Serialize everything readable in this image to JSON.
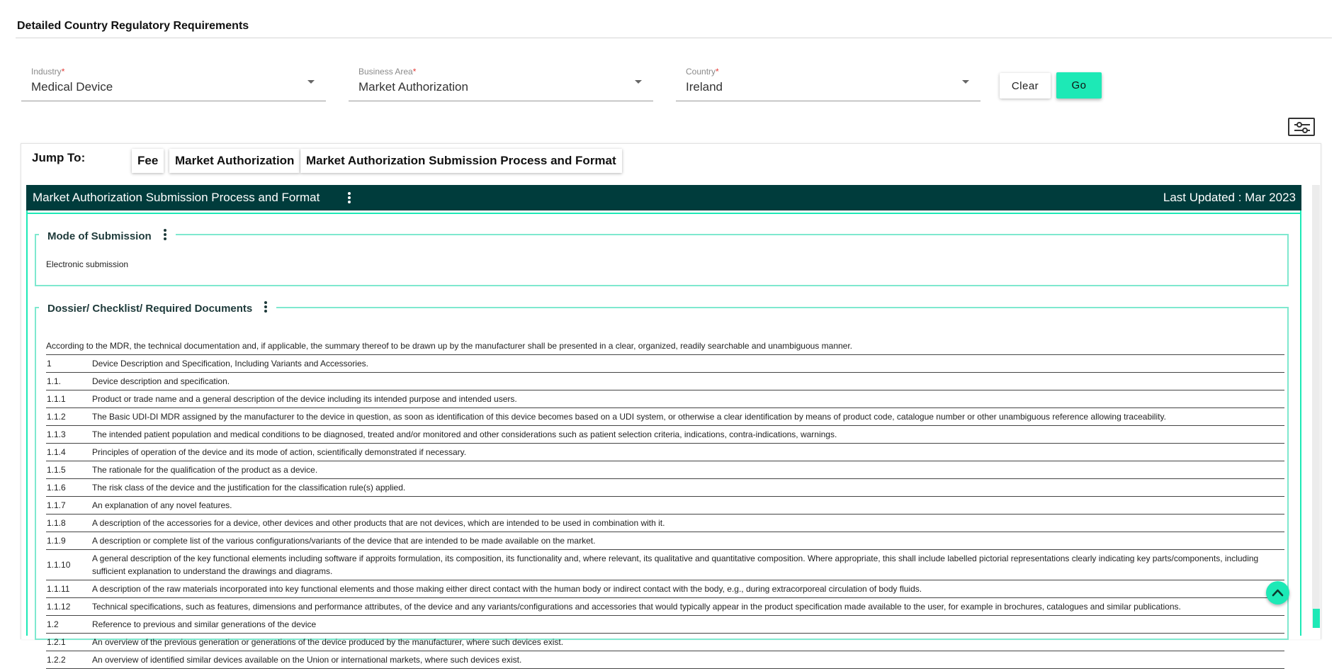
{
  "page": {
    "title": "Detailed Country Regulatory Requirements"
  },
  "filters": {
    "industry": {
      "label": "Industry",
      "value": "Medical Device"
    },
    "business_area": {
      "label": "Business Area",
      "value": "Market Authorization"
    },
    "country": {
      "label": "Country",
      "value": "Ireland"
    },
    "required_marker": "*",
    "clear_label": "Clear",
    "go_label": "Go"
  },
  "icons": {
    "filter": "sliders-icon",
    "dropdown": "caret-down-icon",
    "more": "more-vert-icon",
    "scroll_top": "chevron-up-icon"
  },
  "colors": {
    "accent": "#1de9b6",
    "header_bg": "#003c3c",
    "fieldset_border": "#7fe8cf"
  },
  "jump": {
    "label": "Jump To:",
    "items": [
      "Fee",
      "Market Authorization",
      "Market Authorization Submission Process and Format"
    ]
  },
  "section": {
    "title": "Market Authorization Submission Process and Format",
    "last_updated": "Last Updated : Mar 2023"
  },
  "mode_of_submission": {
    "title": "Mode of Submission",
    "text": "Electronic submission"
  },
  "dossier": {
    "title": "Dossier/ Checklist/ Required Documents",
    "intro": "According to the MDR, the technical documentation and, if applicable, the summary thereof to be drawn up by the manufacturer shall be presented in a clear, organized, readily searchable and unambiguous manner.",
    "rows": [
      {
        "num": "1",
        "text": "Device Description and Specification, Including Variants and Accessories."
      },
      {
        "num": "1.1.",
        "text": "Device description and specification."
      },
      {
        "num": "1.1.1",
        "text": "Product or trade name and a general description of the device including its intended purpose and intended users."
      },
      {
        "num": "1.1.2",
        "text": "The Basic UDI-DI MDR assigned by the manufacturer to the device in question, as soon as identification of this device becomes based on a UDI system, or otherwise a clear identification by means of product code, catalogue number or other unambiguous reference allowing traceability."
      },
      {
        "num": "1.1.3",
        "text": "The intended patient population and medical conditions to be diagnosed, treated and/or monitored and other considerations such as patient selection criteria, indications, contra-indications, warnings."
      },
      {
        "num": "1.1.4",
        "text": "Principles of operation of the device and its mode of action, scientifically demonstrated if necessary."
      },
      {
        "num": "1.1.5",
        "text": "The rationale for the qualification of the product as a device."
      },
      {
        "num": "1.1.6",
        "text": "The risk class of the device and the justification for the classification rule(s) applied."
      },
      {
        "num": "1.1.7",
        "text": " An explanation of any novel features."
      },
      {
        "num": "1.1.8",
        "text": "A description of the accessories for a device, other devices and other products that are not devices, which are intended to be used in combination with it."
      },
      {
        "num": "1.1.9",
        "text": "A description or complete list of the various configurations/variants of the device that are intended to be made available on the market."
      },
      {
        "num": "1.1.10",
        "text": "A general description of the key functional elements including software if approits formulation, its composition, its functionality and, where relevant, its qualitative and quantitative composition. Where appropriate, this shall include labelled pictorial representations clearly indicating key parts/components, including sufficient explanation to understand the drawings and diagrams."
      },
      {
        "num": "1.1.11",
        "text": "A description of the raw materials incorporated into key functional elements and those making either direct contact with the human body or indirect contact with the body, e.g., during extracorporeal circulation of body fluids."
      },
      {
        "num": "1.1.12",
        "text": "Technical specifications, such as features, dimensions and performance attributes, of the device and any variants/configurations and accessories that would typically appear in the product specification made available to the user, for example in brochures, catalogues and similar publications."
      },
      {
        "num": "1.2",
        "text": "Reference to previous and similar generations of the device"
      },
      {
        "num": "1.2.1",
        "text": "An overview of the previous generation or generations of the device produced by the manufacturer, where such devices exist."
      },
      {
        "num": "1.2.2",
        "text": "An overview of identified similar devices available on the Union or international markets, where such devices exist."
      }
    ]
  }
}
